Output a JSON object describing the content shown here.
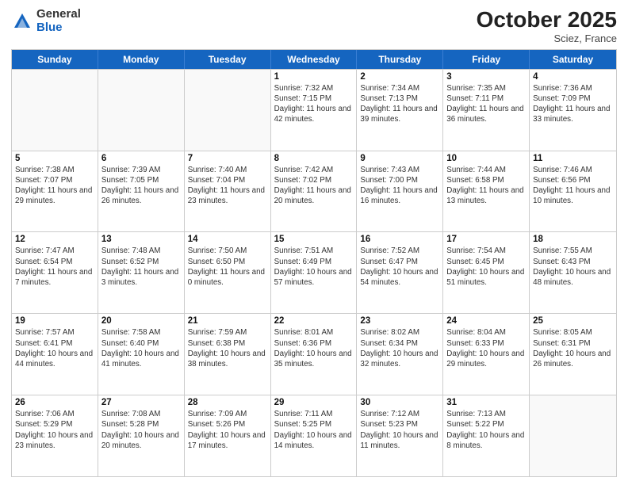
{
  "header": {
    "logo_general": "General",
    "logo_blue": "Blue",
    "month_title": "October 2025",
    "subtitle": "Sciez, France"
  },
  "days_of_week": [
    "Sunday",
    "Monday",
    "Tuesday",
    "Wednesday",
    "Thursday",
    "Friday",
    "Saturday"
  ],
  "weeks": [
    [
      {
        "day": "",
        "info": ""
      },
      {
        "day": "",
        "info": ""
      },
      {
        "day": "",
        "info": ""
      },
      {
        "day": "1",
        "info": "Sunrise: 7:32 AM\nSunset: 7:15 PM\nDaylight: 11 hours and 42 minutes."
      },
      {
        "day": "2",
        "info": "Sunrise: 7:34 AM\nSunset: 7:13 PM\nDaylight: 11 hours and 39 minutes."
      },
      {
        "day": "3",
        "info": "Sunrise: 7:35 AM\nSunset: 7:11 PM\nDaylight: 11 hours and 36 minutes."
      },
      {
        "day": "4",
        "info": "Sunrise: 7:36 AM\nSunset: 7:09 PM\nDaylight: 11 hours and 33 minutes."
      }
    ],
    [
      {
        "day": "5",
        "info": "Sunrise: 7:38 AM\nSunset: 7:07 PM\nDaylight: 11 hours and 29 minutes."
      },
      {
        "day": "6",
        "info": "Sunrise: 7:39 AM\nSunset: 7:05 PM\nDaylight: 11 hours and 26 minutes."
      },
      {
        "day": "7",
        "info": "Sunrise: 7:40 AM\nSunset: 7:04 PM\nDaylight: 11 hours and 23 minutes."
      },
      {
        "day": "8",
        "info": "Sunrise: 7:42 AM\nSunset: 7:02 PM\nDaylight: 11 hours and 20 minutes."
      },
      {
        "day": "9",
        "info": "Sunrise: 7:43 AM\nSunset: 7:00 PM\nDaylight: 11 hours and 16 minutes."
      },
      {
        "day": "10",
        "info": "Sunrise: 7:44 AM\nSunset: 6:58 PM\nDaylight: 11 hours and 13 minutes."
      },
      {
        "day": "11",
        "info": "Sunrise: 7:46 AM\nSunset: 6:56 PM\nDaylight: 11 hours and 10 minutes."
      }
    ],
    [
      {
        "day": "12",
        "info": "Sunrise: 7:47 AM\nSunset: 6:54 PM\nDaylight: 11 hours and 7 minutes."
      },
      {
        "day": "13",
        "info": "Sunrise: 7:48 AM\nSunset: 6:52 PM\nDaylight: 11 hours and 3 minutes."
      },
      {
        "day": "14",
        "info": "Sunrise: 7:50 AM\nSunset: 6:50 PM\nDaylight: 11 hours and 0 minutes."
      },
      {
        "day": "15",
        "info": "Sunrise: 7:51 AM\nSunset: 6:49 PM\nDaylight: 10 hours and 57 minutes."
      },
      {
        "day": "16",
        "info": "Sunrise: 7:52 AM\nSunset: 6:47 PM\nDaylight: 10 hours and 54 minutes."
      },
      {
        "day": "17",
        "info": "Sunrise: 7:54 AM\nSunset: 6:45 PM\nDaylight: 10 hours and 51 minutes."
      },
      {
        "day": "18",
        "info": "Sunrise: 7:55 AM\nSunset: 6:43 PM\nDaylight: 10 hours and 48 minutes."
      }
    ],
    [
      {
        "day": "19",
        "info": "Sunrise: 7:57 AM\nSunset: 6:41 PM\nDaylight: 10 hours and 44 minutes."
      },
      {
        "day": "20",
        "info": "Sunrise: 7:58 AM\nSunset: 6:40 PM\nDaylight: 10 hours and 41 minutes."
      },
      {
        "day": "21",
        "info": "Sunrise: 7:59 AM\nSunset: 6:38 PM\nDaylight: 10 hours and 38 minutes."
      },
      {
        "day": "22",
        "info": "Sunrise: 8:01 AM\nSunset: 6:36 PM\nDaylight: 10 hours and 35 minutes."
      },
      {
        "day": "23",
        "info": "Sunrise: 8:02 AM\nSunset: 6:34 PM\nDaylight: 10 hours and 32 minutes."
      },
      {
        "day": "24",
        "info": "Sunrise: 8:04 AM\nSunset: 6:33 PM\nDaylight: 10 hours and 29 minutes."
      },
      {
        "day": "25",
        "info": "Sunrise: 8:05 AM\nSunset: 6:31 PM\nDaylight: 10 hours and 26 minutes."
      }
    ],
    [
      {
        "day": "26",
        "info": "Sunrise: 7:06 AM\nSunset: 5:29 PM\nDaylight: 10 hours and 23 minutes."
      },
      {
        "day": "27",
        "info": "Sunrise: 7:08 AM\nSunset: 5:28 PM\nDaylight: 10 hours and 20 minutes."
      },
      {
        "day": "28",
        "info": "Sunrise: 7:09 AM\nSunset: 5:26 PM\nDaylight: 10 hours and 17 minutes."
      },
      {
        "day": "29",
        "info": "Sunrise: 7:11 AM\nSunset: 5:25 PM\nDaylight: 10 hours and 14 minutes."
      },
      {
        "day": "30",
        "info": "Sunrise: 7:12 AM\nSunset: 5:23 PM\nDaylight: 10 hours and 11 minutes."
      },
      {
        "day": "31",
        "info": "Sunrise: 7:13 AM\nSunset: 5:22 PM\nDaylight: 10 hours and 8 minutes."
      },
      {
        "day": "",
        "info": ""
      }
    ]
  ]
}
